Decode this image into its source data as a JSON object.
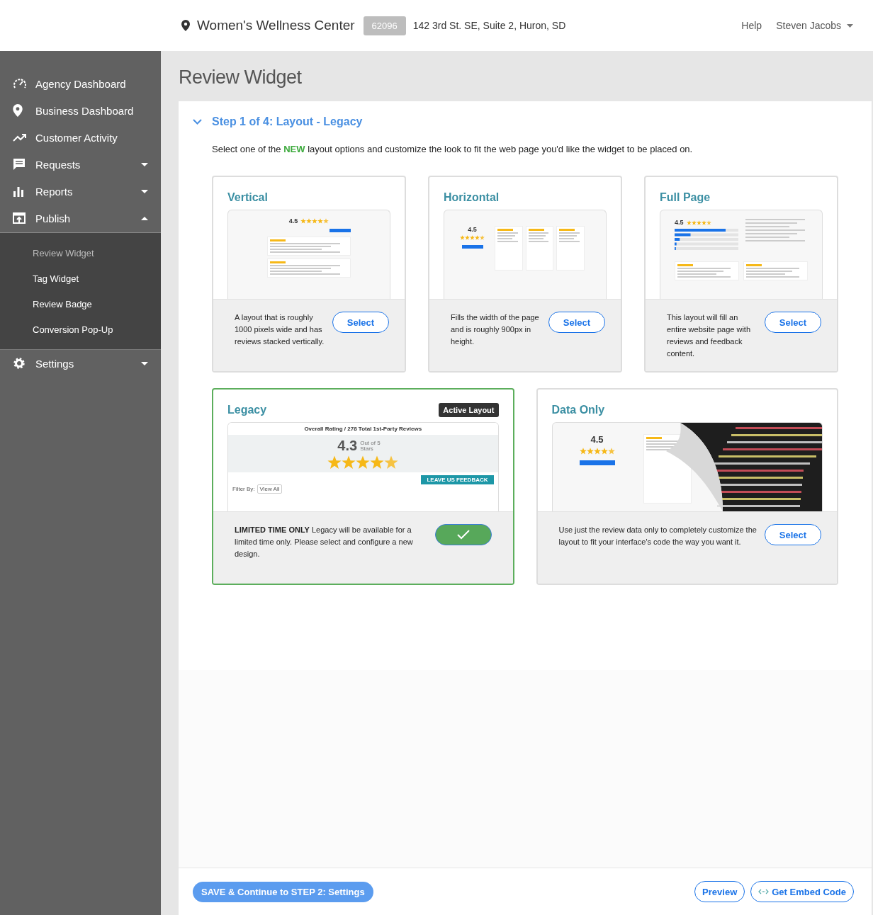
{
  "header": {
    "location": "Women's Wellness Center",
    "location_id": "62096",
    "address": "142 3rd St. SE, Suite 2, Huron, SD",
    "help": "Help",
    "user": "Steven Jacobs"
  },
  "sidebar": {
    "items": [
      {
        "label": "Agency Dashboard"
      },
      {
        "label": "Business Dashboard"
      },
      {
        "label": "Customer Activity"
      },
      {
        "label": "Requests",
        "expanded": false
      },
      {
        "label": "Reports",
        "expanded": false
      },
      {
        "label": "Publish",
        "expanded": true,
        "children": [
          {
            "label": "Review Widget",
            "selected": true
          },
          {
            "label": "Tag Widget",
            "selected": false
          },
          {
            "label": "Review Badge",
            "selected": false
          },
          {
            "label": "Conversion Pop-Up",
            "selected": false
          }
        ]
      },
      {
        "label": "Settings",
        "expanded": false
      }
    ]
  },
  "page_title": "Review Widget",
  "step": {
    "title": "Step 1 of 4: Layout - Legacy",
    "expanded": true,
    "intro": "Select one of the **NEW** layout options and customize the look to fit the web page you'd like the widget to be placed on."
  },
  "layouts": [
    {
      "kind": "vertical",
      "title": "Vertical",
      "active": false,
      "rating": "4.5",
      "description": "A layout that is roughly 1000 pixels wide and has reviews stacked vertically.",
      "button": "Select"
    },
    {
      "kind": "horizontal",
      "title": "Horizontal",
      "active": false,
      "rating": "4.5",
      "description": "Fills the width of the page and is roughly 900px in height.",
      "button": "Select"
    },
    {
      "kind": "fullpage",
      "title": "Full Page",
      "active": false,
      "rating": "4.5",
      "description": "This layout will fill an entire website page with reviews and feedback content.",
      "button": "Select"
    },
    {
      "kind": "legacy",
      "title": "Legacy",
      "active": true,
      "badge": "Active Layout",
      "rating": "4.3",
      "heading": "Overall Rating / 278 Total 1st-Party Reviews",
      "rating_caption": "Out of 5 Stars",
      "feedback": "LEAVE US FEEDBACK",
      "filter_label": "Filter By:",
      "filter_value": "View All",
      "description": "**LIMITED TIME ONLY** Legacy will be available for a limited time only. Please select and configure a new design."
    },
    {
      "kind": "dataonly",
      "title": "Data Only",
      "active": false,
      "rating": "4.5",
      "description": "Use just the review data only to completely customize the layout to fit your interface's code the way you want it.",
      "button": "Select"
    }
  ],
  "footer": {
    "save": "SAVE & Continue to STEP 2: Settings",
    "preview": "Preview",
    "embed": "Get Embed Code"
  }
}
